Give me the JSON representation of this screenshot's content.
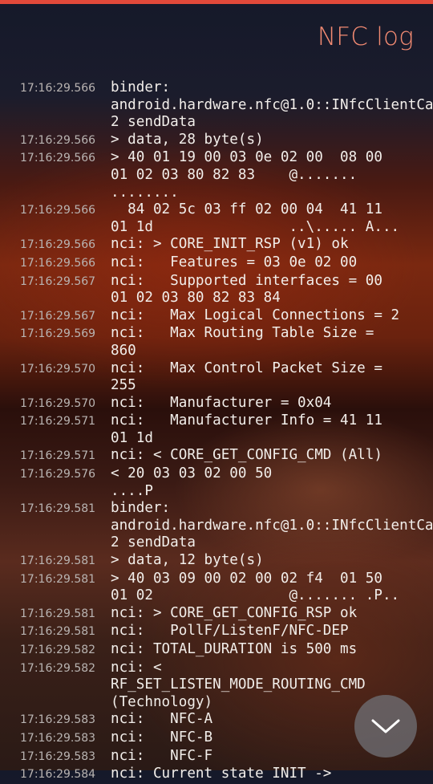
{
  "header": {
    "title": "NFC log"
  },
  "log": [
    {
      "time": "17:16:29.566",
      "text": "binder:\nandroid.hardware.nfc@1.0::INfcClientCa\n2 sendData"
    },
    {
      "time": "17:16:29.566",
      "text": "> data, 28 byte(s)"
    },
    {
      "time": "17:16:29.566",
      "text": "> 40 01 19 00 03 0e 02 00  08 00\n01 02 03 80 82 83    @.......\n........"
    },
    {
      "time": "17:16:29.566",
      "text": "  84 02 5c 03 ff 02 00 04  41 11\n01 1d                ..\\..... A..."
    },
    {
      "time": "17:16:29.566",
      "text": "nci: > CORE_INIT_RSP (v1) ok"
    },
    {
      "time": "17:16:29.566",
      "text": "nci:   Features = 03 0e 02 00"
    },
    {
      "time": "17:16:29.567",
      "text": "nci:   Supported interfaces = 00\n01 02 03 80 82 83 84"
    },
    {
      "time": "17:16:29.567",
      "text": "nci:   Max Logical Connections = 2"
    },
    {
      "time": "17:16:29.569",
      "text": "nci:   Max Routing Table Size =\n860"
    },
    {
      "time": "17:16:29.570",
      "text": "nci:   Max Control Packet Size =\n255"
    },
    {
      "time": "17:16:29.570",
      "text": "nci:   Manufacturer = 0x04"
    },
    {
      "time": "17:16:29.571",
      "text": "nci:   Manufacturer Info = 41 11\n01 1d"
    },
    {
      "time": "17:16:29.571",
      "text": "nci: < CORE_GET_CONFIG_CMD (All)"
    },
    {
      "time": "17:16:29.576",
      "text": "< 20 03 03 02 00 50\n....P"
    },
    {
      "time": "17:16:29.581",
      "text": "binder:\nandroid.hardware.nfc@1.0::INfcClientCa\n2 sendData"
    },
    {
      "time": "17:16:29.581",
      "text": "> data, 12 byte(s)"
    },
    {
      "time": "17:16:29.581",
      "text": "> 40 03 09 00 02 00 02 f4  01 50\n01 02                @....... .P.."
    },
    {
      "time": "17:16:29.581",
      "text": "nci: > CORE_GET_CONFIG_RSP ok"
    },
    {
      "time": "17:16:29.581",
      "text": "nci:   PollF/ListenF/NFC-DEP"
    },
    {
      "time": "17:16:29.582",
      "text": "nci: TOTAL_DURATION is 500 ms"
    },
    {
      "time": "17:16:29.582",
      "text": "nci: <\nRF_SET_LISTEN_MODE_ROUTING_CMD\n(Technology)"
    },
    {
      "time": "17:16:29.583",
      "text": "nci:   NFC-A"
    },
    {
      "time": "17:16:29.583",
      "text": "nci:   NFC-B"
    },
    {
      "time": "17:16:29.583",
      "text": "nci:   NFC-F"
    },
    {
      "time": "17:16:29.584",
      "text": "nci: Current state INIT ->"
    }
  ],
  "scroll_button": {
    "icon": "chevron-down-icon"
  },
  "colors": {
    "accent": "#e2493a",
    "title": "#f28a72"
  }
}
